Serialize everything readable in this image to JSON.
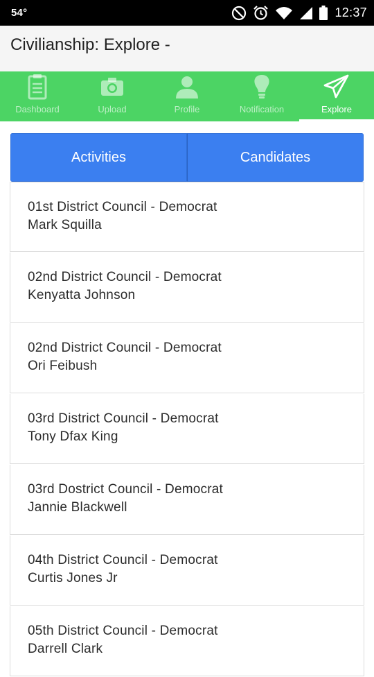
{
  "status_bar": {
    "temperature": "54°",
    "time": "12:37",
    "icons": [
      "do-not-disturb-icon",
      "alarm-icon",
      "wifi-icon",
      "signal-icon",
      "battery-icon"
    ]
  },
  "header": {
    "title": "Civilianship: Explore -"
  },
  "nav": {
    "items": [
      {
        "label": "Dashboard",
        "icon": "clipboard-icon"
      },
      {
        "label": "Upload",
        "icon": "camera-icon"
      },
      {
        "label": "Profile",
        "icon": "person-icon"
      },
      {
        "label": "Notification",
        "icon": "lightbulb-icon"
      },
      {
        "label": "Explore",
        "icon": "paper-plane-icon"
      }
    ],
    "active": "Explore"
  },
  "segment": {
    "activities_label": "Activities",
    "candidates_label": "Candidates"
  },
  "candidates": [
    {
      "district": "01st District Council - Democrat",
      "name": "Mark Squilla"
    },
    {
      "district": "02nd District Council - Democrat",
      "name": "Kenyatta Johnson"
    },
    {
      "district": "02nd District Council - Democrat",
      "name": "Ori Feibush"
    },
    {
      "district": "03rd District Council - Democrat",
      "name": "Tony Dfax King"
    },
    {
      "district": "03rd Dostrict Council - Democrat",
      "name": "Jannie Blackwell"
    },
    {
      "district": "04th District Council - Democrat",
      "name": "Curtis Jones Jr"
    },
    {
      "district": "05th District Council - Democrat",
      "name": "Darrell Clark"
    }
  ],
  "colors": {
    "nav_green": "#4cd464",
    "button_blue": "#3b7ff0",
    "status_bar": "#000000"
  }
}
